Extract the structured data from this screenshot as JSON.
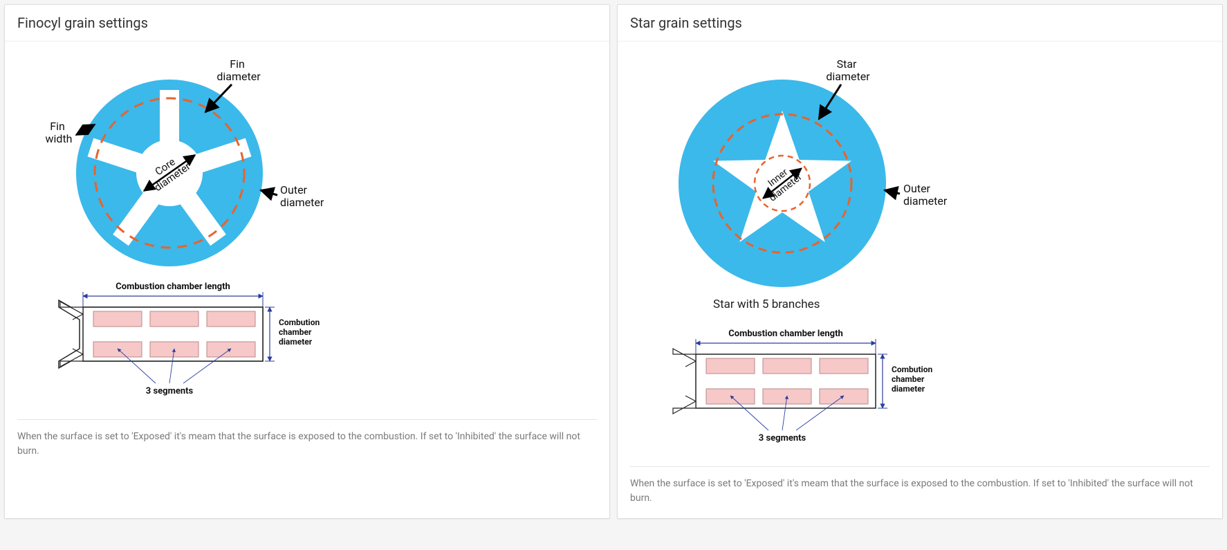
{
  "panels": {
    "finocyl": {
      "title": "Finocyl grain settings",
      "labels": {
        "fin_diameter": "Fin diameter",
        "fin_width": "Fin width",
        "core_diameter": "Core diameter",
        "outer_diameter": "Outer diameter"
      },
      "chamber": {
        "combustion_chamber_length": "Combustion chamber length",
        "combustion_chamber_diameter": "Combution chamber diameter",
        "segments_label": "3 segments"
      },
      "help": "When the surface is set to 'Exposed' it's meam that the surface is exposed to the combustion. If set to 'Inhibited' the surface will not burn."
    },
    "star": {
      "title": "Star grain settings",
      "labels": {
        "star_diameter": "Star diameter",
        "inner_diameter": "Inner diameter",
        "outer_diameter": "Outer diameter"
      },
      "caption": "Star with 5 branches",
      "chamber": {
        "combustion_chamber_length": "Combustion chamber length",
        "combustion_chamber_diameter": "Combution chamber diameter",
        "segments_label": "3 segments"
      },
      "help": "When the surface is set to 'Exposed' it's meam that the surface is exposed to the combustion. If set to 'Inhibited' the surface will not burn."
    }
  },
  "colors": {
    "grain_fill": "#3bb9ea",
    "dashed_circle": "#e8632c",
    "segment_fill": "#f6c8c8",
    "dimension_line": "#2a3e9e"
  }
}
